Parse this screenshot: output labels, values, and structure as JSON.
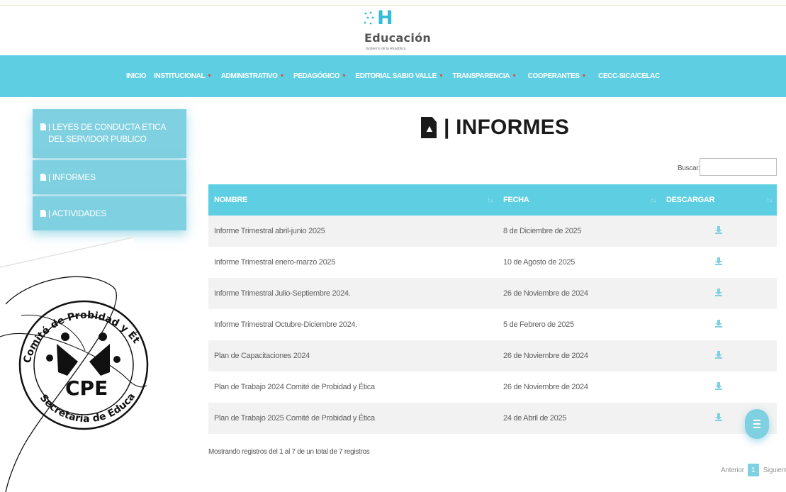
{
  "colors": {
    "accent": "#5ecfe2",
    "sidebar": "#7fd0e0",
    "caret": "#e0463c",
    "title": "#1b1b1b"
  },
  "logo": {
    "mark": "H",
    "name": "Educación",
    "subtitle": "Gobierno de la República"
  },
  "nav": [
    {
      "label": "INICIO",
      "has_dropdown": false
    },
    {
      "label": "INSTITUCIONAL",
      "has_dropdown": true
    },
    {
      "label": "ADMINISTRATIVO",
      "has_dropdown": true
    },
    {
      "label": "PEDAGÓGICO",
      "has_dropdown": true
    },
    {
      "label": "EDITORIAL SABIO VALLE",
      "has_dropdown": true
    },
    {
      "label": "TRANSPARENCIA",
      "has_dropdown": true
    },
    {
      "label": "COOPERANTES",
      "has_dropdown": true
    },
    {
      "label": "CECC-SICA/CELAC",
      "has_dropdown": false
    }
  ],
  "sidebar": {
    "items": [
      {
        "label": "| LEYES DE CONDUCTA ETICA DEL SERVIDOR PUBLICO",
        "icon": "file-icon"
      },
      {
        "label": "| INFORMES",
        "icon": "file-icon"
      },
      {
        "label": "| ACTIVIDADES",
        "icon": "file-icon"
      }
    ]
  },
  "stamp": {
    "top": "Comité de Probidad y Ética",
    "center": "CPE",
    "bottom": "Secretaria de Educación"
  },
  "page": {
    "title": "| INFORMES",
    "pdf_icon_label": "PDF"
  },
  "search": {
    "label": "Buscar:",
    "value": "",
    "placeholder": ""
  },
  "table": {
    "columns": [
      "NOMBRE",
      "FECHA",
      "DESCARGAR"
    ],
    "rows": [
      {
        "nombre": "Informe Trimestral abril-junio 2025",
        "fecha": "8 de Diciembre de 2025"
      },
      {
        "nombre": "Informe Trimestral enero-marzo 2025",
        "fecha": "10 de Agosto de 2025"
      },
      {
        "nombre": "Informe Trimestral Julio-Septiembre 2024.",
        "fecha": "26 de Noviembre de 2024"
      },
      {
        "nombre": "Informe Trimestral Octubre-Diciembre 2024.",
        "fecha": "5 de Febrero de 2025"
      },
      {
        "nombre": "Plan de Capacitaciones 2024",
        "fecha": "26 de Noviembre de 2024"
      },
      {
        "nombre": "Plan de Trabajo 2024 Comité de Probidad y Ética",
        "fecha": "26 de Noviembre de 2024"
      },
      {
        "nombre": "Plan de Trabajo 2025 Comité de Probidad y Ética",
        "fecha": "24 de Abril de 2025"
      }
    ]
  },
  "info": "Mostrando registros del 1 al 7 de un total de 7 registros",
  "pager": {
    "prev": "Anterior",
    "current": "1",
    "next": "Siguiente"
  }
}
